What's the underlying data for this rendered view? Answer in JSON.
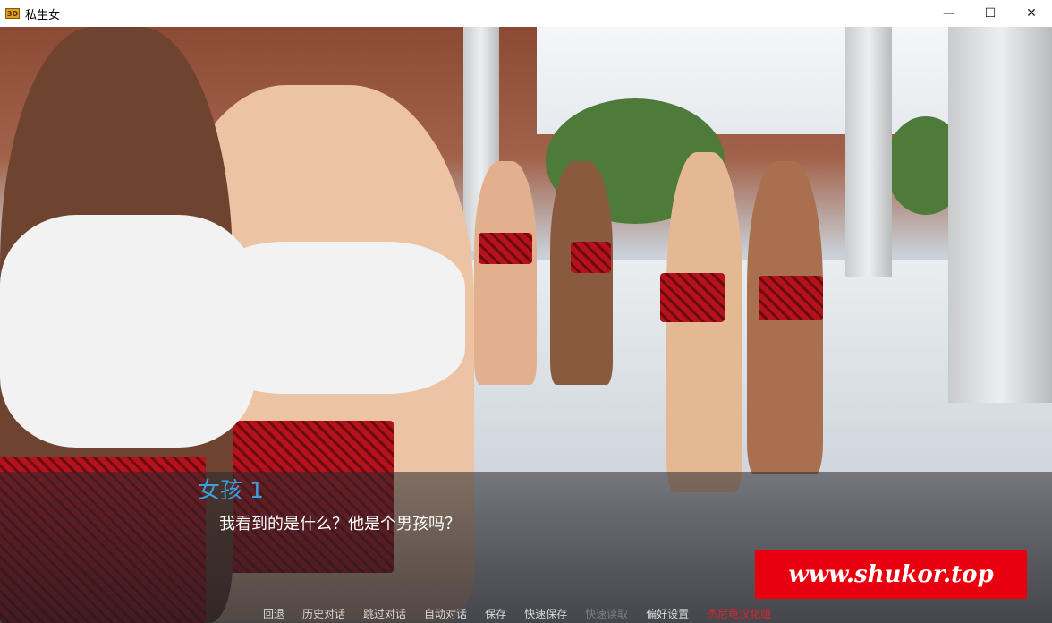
{
  "window": {
    "title": "私生女",
    "icon_text": "3D",
    "minimize": "—",
    "maximize": "☐",
    "close": "✕"
  },
  "dialogue": {
    "speaker": "女孩 1",
    "text": "我看到的是什么？他是个男孩吗？"
  },
  "watermark": "www.shukor.top",
  "quick_menu": [
    {
      "label": "回退",
      "state": "normal"
    },
    {
      "label": "历史对话",
      "state": "normal"
    },
    {
      "label": "跳过对话",
      "state": "normal"
    },
    {
      "label": "自动对话",
      "state": "normal"
    },
    {
      "label": "保存",
      "state": "normal"
    },
    {
      "label": "快速保存",
      "state": "normal"
    },
    {
      "label": "快速读取",
      "state": "disabled"
    },
    {
      "label": "偏好设置",
      "state": "normal"
    },
    {
      "label": "杰尼龟汉化组",
      "state": "highlight"
    }
  ],
  "colors": {
    "speaker": "#3aa0e0",
    "watermark_bg": "#e8000e",
    "skirt": "#b5121b"
  }
}
